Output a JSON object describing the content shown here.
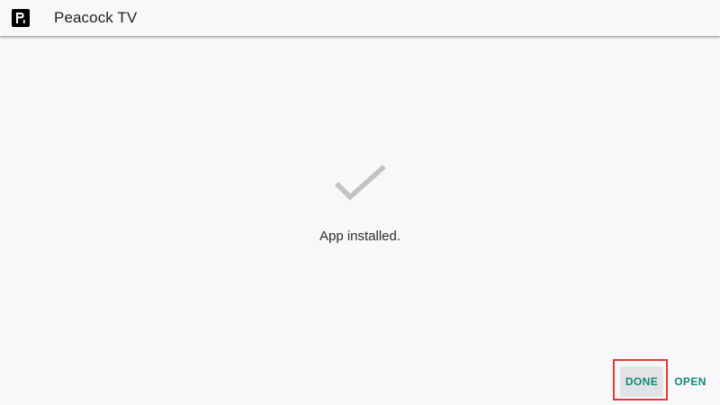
{
  "app_bar": {
    "icon": "peacock-p-logo-icon",
    "title": "Peacock TV"
  },
  "main": {
    "status_icon": "checkmark-icon",
    "status_text": "App installed."
  },
  "actions": {
    "done_label": "DONE",
    "open_label": "OPEN"
  },
  "colors": {
    "background": "#f8f7f9",
    "accent": "#0f8a7a",
    "focus_highlight": "#e03a3a",
    "check": "#c2c2c2",
    "done_bg": "#e3e3e5"
  }
}
